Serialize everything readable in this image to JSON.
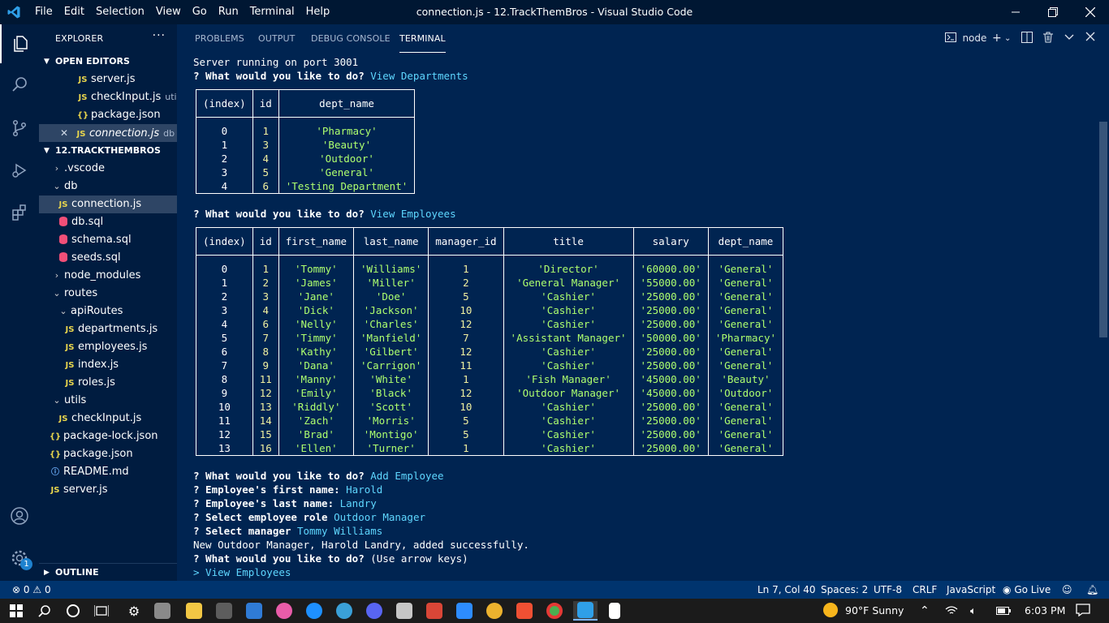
{
  "window": {
    "title": "connection.js - 12.TrackThemBros - Visual Studio Code",
    "menu": [
      "File",
      "Edit",
      "Selection",
      "View",
      "Go",
      "Run",
      "Terminal",
      "Help"
    ]
  },
  "sidebar": {
    "title": "EXPLORER",
    "more": "···",
    "open_editors_label": "OPEN EDITORS",
    "open_editors": [
      {
        "name": "server.js",
        "icon": "JS",
        "desc": ""
      },
      {
        "name": "checkInput.js",
        "icon": "JS",
        "desc": "utils"
      },
      {
        "name": "package.json",
        "icon": "{}",
        "desc": ""
      },
      {
        "name": "connection.js",
        "icon": "JS",
        "desc": "db"
      }
    ],
    "project_label": "12.TRACKTHEMBROS",
    "tree": [
      {
        "name": ".vscode",
        "type": "folder",
        "open": false
      },
      {
        "name": "db",
        "type": "folder",
        "open": true
      },
      {
        "name": "connection.js",
        "type": "js"
      },
      {
        "name": "db.sql",
        "type": "sql"
      },
      {
        "name": "schema.sql",
        "type": "sql"
      },
      {
        "name": "seeds.sql",
        "type": "sql"
      },
      {
        "name": "node_modules",
        "type": "folder",
        "open": false
      },
      {
        "name": "routes",
        "type": "folder",
        "open": true
      },
      {
        "name": "apiRoutes",
        "type": "folder",
        "open": true
      },
      {
        "name": "departments.js",
        "type": "js"
      },
      {
        "name": "employees.js",
        "type": "js"
      },
      {
        "name": "index.js",
        "type": "js"
      },
      {
        "name": "roles.js",
        "type": "js"
      },
      {
        "name": "utils",
        "type": "folder",
        "open": true
      },
      {
        "name": "checkInput.js",
        "type": "js"
      },
      {
        "name": "package-lock.json",
        "type": "json"
      },
      {
        "name": "package.json",
        "type": "json"
      },
      {
        "name": "README.md",
        "type": "info"
      },
      {
        "name": "server.js",
        "type": "js"
      }
    ],
    "outline_label": "OUTLINE"
  },
  "panel": {
    "tabs": [
      "PROBLEMS",
      "OUTPUT",
      "DEBUG CONSOLE",
      "TERMINAL"
    ],
    "active_tab": "TERMINAL",
    "terminal_name": "node"
  },
  "terminal": {
    "server_line": "Server running on port 3001",
    "prompt": "? What would you like to do?",
    "choice1": "View Departments",
    "choice2": "View Employees",
    "choice3": "Add Employee",
    "dept_headers": [
      "(index)",
      "id",
      "dept_name"
    ],
    "dept_rows": [
      [
        "0",
        "1",
        "'Pharmacy'"
      ],
      [
        "1",
        "3",
        "'Beauty'"
      ],
      [
        "2",
        "4",
        "'Outdoor'"
      ],
      [
        "3",
        "5",
        "'General'"
      ],
      [
        "4",
        "6",
        "'Testing Department'"
      ]
    ],
    "emp_headers": [
      "(index)",
      "id",
      "first_name",
      "last_name",
      "manager_id",
      "title",
      "salary",
      "dept_name"
    ],
    "emp_rows": [
      [
        "0",
        "1",
        "'Tommy'",
        "'Williams'",
        "1",
        "'Director'",
        "'60000.00'",
        "'General'"
      ],
      [
        "1",
        "2",
        "'James'",
        "'Miller'",
        "2",
        "'General Manager'",
        "'55000.00'",
        "'General'"
      ],
      [
        "2",
        "3",
        "'Jane'",
        "'Doe'",
        "5",
        "'Cashier'",
        "'25000.00'",
        "'General'"
      ],
      [
        "3",
        "4",
        "'Dick'",
        "'Jackson'",
        "10",
        "'Cashier'",
        "'25000.00'",
        "'General'"
      ],
      [
        "4",
        "6",
        "'Nelly'",
        "'Charles'",
        "12",
        "'Cashier'",
        "'25000.00'",
        "'General'"
      ],
      [
        "5",
        "7",
        "'Timmy'",
        "'Manfield'",
        "7",
        "'Assistant Manager'",
        "'50000.00'",
        "'Pharmacy'"
      ],
      [
        "6",
        "8",
        "'Kathy'",
        "'Gilbert'",
        "12",
        "'Cashier'",
        "'25000.00'",
        "'General'"
      ],
      [
        "7",
        "9",
        "'Dana'",
        "'Carrigon'",
        "11",
        "'Cashier'",
        "'25000.00'",
        "'General'"
      ],
      [
        "8",
        "11",
        "'Manny'",
        "'White'",
        "1",
        "'Fish Manager'",
        "'45000.00'",
        "'Beauty'"
      ],
      [
        "9",
        "12",
        "'Emily'",
        "'Black'",
        "12",
        "'Outdoor Manager'",
        "'45000.00'",
        "'Outdoor'"
      ],
      [
        "10",
        "13",
        "'Riddly'",
        "'Scott'",
        "10",
        "'Cashier'",
        "'25000.00'",
        "'General'"
      ],
      [
        "11",
        "14",
        "'Zach'",
        "'Morris'",
        "5",
        "'Cashier'",
        "'25000.00'",
        "'General'"
      ],
      [
        "12",
        "15",
        "'Brad'",
        "'Montigo'",
        "5",
        "'Cashier'",
        "'25000.00'",
        "'General'"
      ],
      [
        "13",
        "16",
        "'Ellen'",
        "'Turner'",
        "1",
        "'Cashier'",
        "'25000.00'",
        "'General'"
      ]
    ],
    "first_name_q": "? Employee's first name:",
    "first_name_a": "Harold",
    "last_name_q": "? Employee's last name:",
    "last_name_a": "Landry",
    "role_q": "? Select employee role",
    "role_a": "Outdoor Manager",
    "manager_q": "? Select manager",
    "manager_a": "Tommy Williams",
    "success": "New Outdoor Manager, Harold Landry, added successfully.",
    "hint": "(Use arrow keys)",
    "cursor_item": "> View Employees"
  },
  "statusbar": {
    "errors": "0",
    "warnings": "0",
    "position": "Ln 7, Col 40",
    "spaces": "Spaces: 2",
    "encoding": "UTF-8",
    "eol": "CRLF",
    "language": "JavaScript",
    "golive": "Go Live"
  },
  "taskbar": {
    "weather": "90°F  Sunny",
    "time": "6:03 PM"
  },
  "notif_badge": "1",
  "colors": {
    "background": "#002451",
    "sidebar": "#001c40",
    "statusbar": "#00346e",
    "answer": "#5fd7ff",
    "string": "#aeff6f",
    "number": "#f0f0a0"
  }
}
